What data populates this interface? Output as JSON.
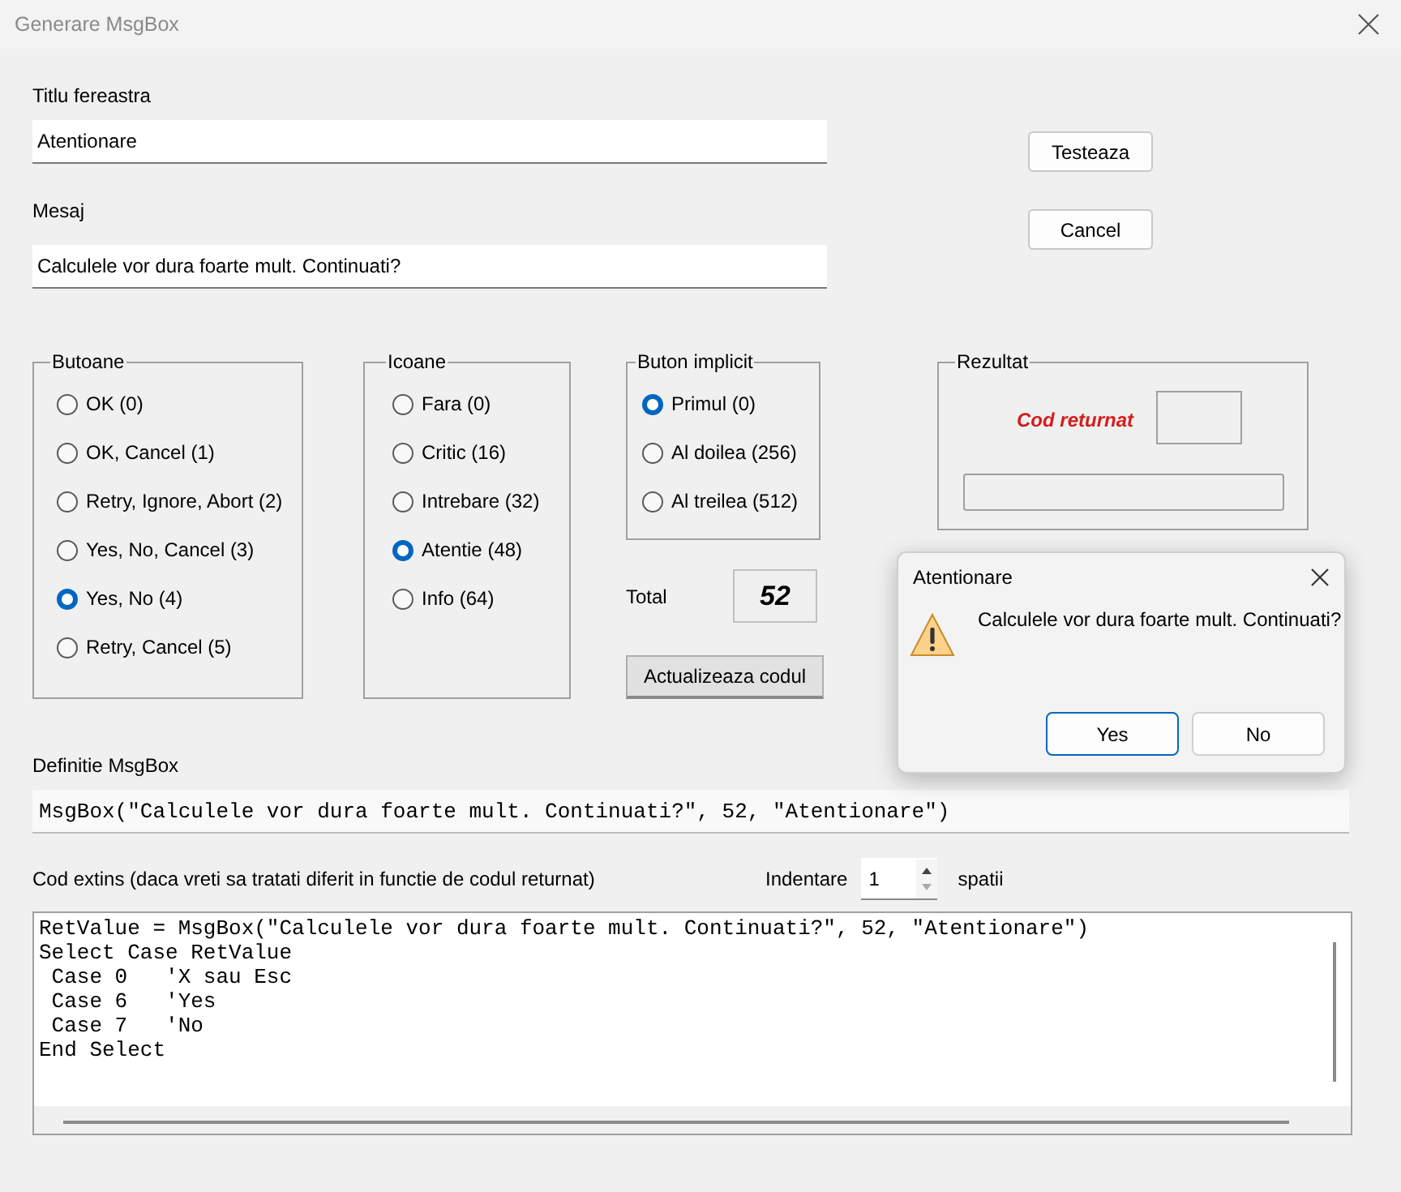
{
  "window": {
    "title": "Generare MsgBox"
  },
  "fields": [
    {
      "label": "Titlu fereastra",
      "value": "Atentionare"
    },
    {
      "label": "Mesaj",
      "value": "Calculele vor dura foarte mult. Continuati?"
    }
  ],
  "actions": [
    "Testeaza",
    "Cancel"
  ],
  "groups": [
    {
      "title": "Butoane",
      "options": [
        {
          "label": "OK (0)",
          "selected": false
        },
        {
          "label": "OK, Cancel (1)",
          "selected": false
        },
        {
          "label": "Retry, Ignore, Abort (2)",
          "selected": false
        },
        {
          "label": "Yes, No, Cancel (3)",
          "selected": false
        },
        {
          "label": "Yes, No (4)",
          "selected": true
        },
        {
          "label": "Retry, Cancel (5)",
          "selected": false
        }
      ]
    },
    {
      "title": "Icoane",
      "options": [
        {
          "label": "Fara (0)",
          "selected": false
        },
        {
          "label": "Critic (16)",
          "selected": false
        },
        {
          "label": "Intrebare (32)",
          "selected": false
        },
        {
          "label": "Atentie (48)",
          "selected": true
        },
        {
          "label": "Info (64)",
          "selected": false
        }
      ]
    },
    {
      "title": "Buton implicit",
      "options": [
        {
          "label": "Primul (0)",
          "selected": true
        },
        {
          "label": "Al doilea (256)",
          "selected": false
        },
        {
          "label": "Al treilea (512)",
          "selected": false
        }
      ]
    }
  ],
  "total": {
    "label": "Total",
    "value": "52"
  },
  "update_button": "Actualizeaza codul",
  "result": {
    "title": "Rezultat",
    "code_label": "Cod returnat"
  },
  "definition": {
    "label": "Definitie MsgBox",
    "value": "MsgBox(\"Calculele vor dura foarte mult. Continuati?\", 52, \"Atentionare\")"
  },
  "extended": {
    "label": "Cod extins (daca vreti sa tratati diferit in functie de codul returnat)",
    "indent_label": "Indentare",
    "indent_value": "1",
    "indent_unit": "spatii",
    "lines": [
      "RetValue = MsgBox(\"Calculele vor dura foarte mult. Continuati?\", 52, \"Atentionare\")",
      "Select Case RetValue",
      " Case 0   'X sau Esc",
      " Case 6   'Yes",
      " Case 7   'No",
      "End Select"
    ]
  },
  "dialog": {
    "title": "Atentionare",
    "message": "Calculele vor dura foarte mult. Continuati?",
    "buttons": [
      {
        "label": "Yes",
        "selected": true
      },
      {
        "label": "No",
        "selected": false
      }
    ]
  }
}
